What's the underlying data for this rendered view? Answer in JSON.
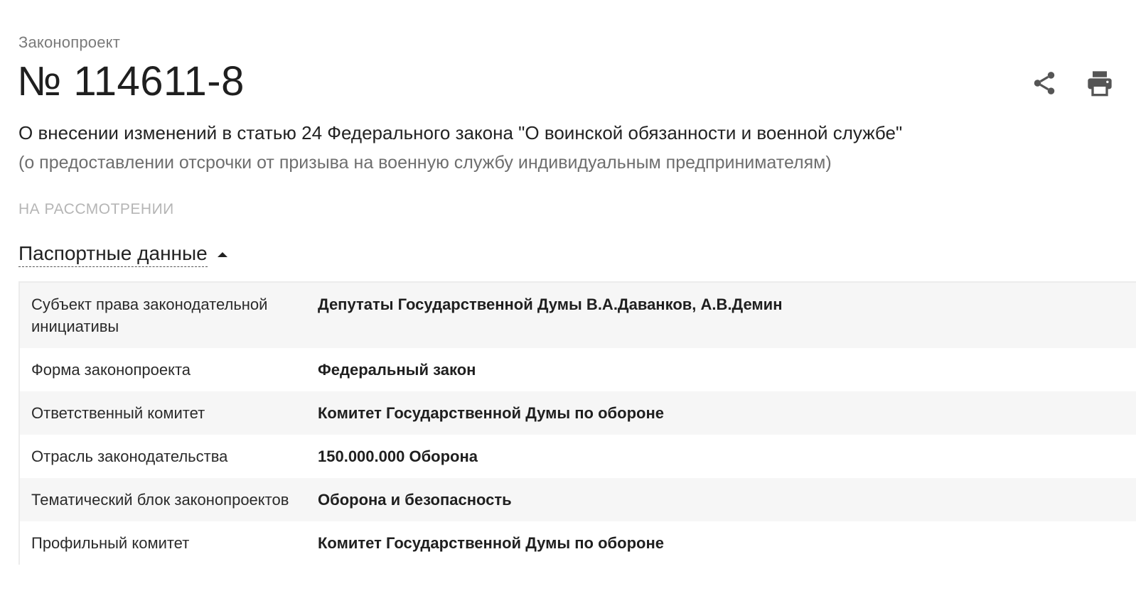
{
  "header": {
    "eyebrow": "Законопроект",
    "bill_number": "№ 114611-8",
    "title": "О внесении изменений в статью 24 Федерального закона \"О воинской обязанности и военной службе\"",
    "subtitle": "(о предоставлении отсрочки от призыва на военную службу индивидуальным предпринимателям)",
    "status": "НА РАССМОТРЕНИИ",
    "actions": {
      "share_icon": "share-icon",
      "print_icon": "print-icon"
    }
  },
  "passport": {
    "section_label": "Паспортные данные",
    "rows": [
      {
        "key": "Субъект права законодательной инициативы",
        "value": "Депутаты Государственной Думы В.А.Даванков, А.В.Демин"
      },
      {
        "key": "Форма законопроекта",
        "value": "Федеральный закон"
      },
      {
        "key": "Ответственный комитет",
        "value": "Комитет Государственной Думы по обороне"
      },
      {
        "key": "Отрасль законодательства",
        "value": "150.000.000 Оборона"
      },
      {
        "key": "Тематический блок законопроектов",
        "value": "Оборона и безопасность"
      },
      {
        "key": "Профильный комитет",
        "value": "Комитет Государственной Думы по обороне"
      }
    ]
  },
  "colors": {
    "text": "#222222",
    "muted": "#6e6e6e",
    "status": "#b5b5b5",
    "row_alt": "#f6f6f6",
    "icon": "#555555"
  }
}
